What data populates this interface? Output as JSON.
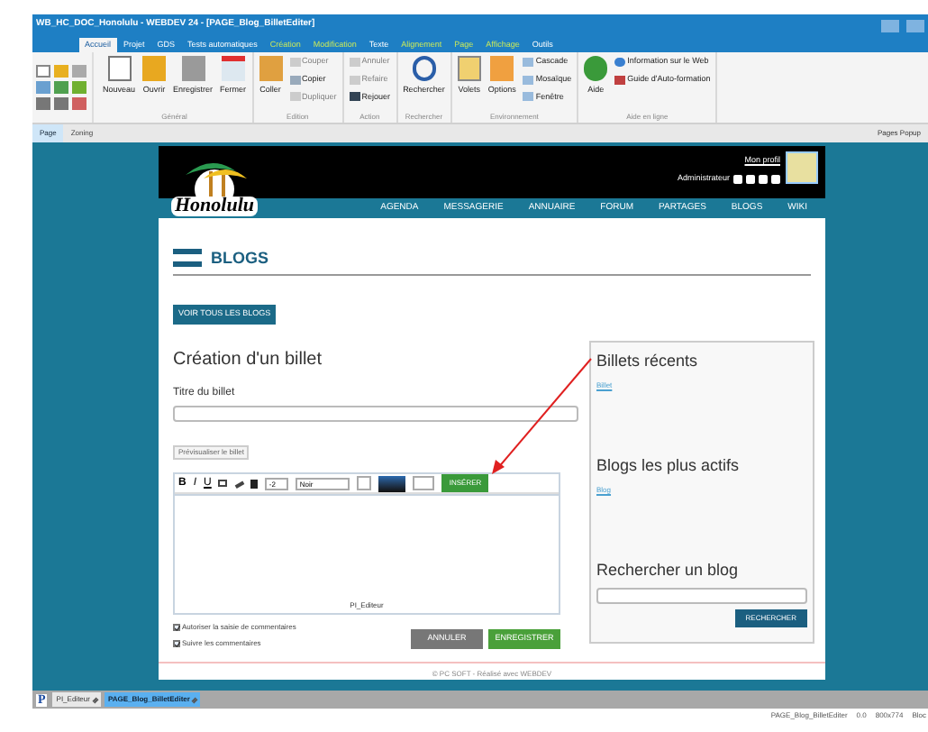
{
  "window": {
    "title": "WB_HC_DOC_Honolulu - WEBDEV 24 - [PAGE_Blog_BilletEditer]"
  },
  "ribbon_tabs": [
    {
      "label": "Accueil",
      "selected": true,
      "contextual": false
    },
    {
      "label": "Projet",
      "selected": false,
      "contextual": false
    },
    {
      "label": "GDS",
      "selected": false,
      "contextual": false
    },
    {
      "label": "Tests automatiques",
      "selected": false,
      "contextual": false
    },
    {
      "label": "Création",
      "selected": false,
      "contextual": true
    },
    {
      "label": "Modification",
      "selected": false,
      "contextual": true
    },
    {
      "label": "Texte",
      "selected": false,
      "contextual": false
    },
    {
      "label": "Alignement",
      "selected": false,
      "contextual": true
    },
    {
      "label": "Page",
      "selected": false,
      "contextual": true
    },
    {
      "label": "Affichage",
      "selected": false,
      "contextual": true
    },
    {
      "label": "Outils",
      "selected": false,
      "contextual": false
    }
  ],
  "ribbon_groups": [
    {
      "label": "Général",
      "items": [
        {
          "label": "Nouveau",
          "kind": "large",
          "disabled": false
        },
        {
          "label": "Ouvrir",
          "kind": "large",
          "disabled": false
        },
        {
          "label": "Enregistrer",
          "kind": "large",
          "disabled": false
        },
        {
          "label": "Fermer",
          "kind": "large",
          "disabled": false
        }
      ]
    },
    {
      "label": "Edition",
      "items": [
        {
          "label": "Coller",
          "kind": "large",
          "disabled": false
        },
        {
          "label": "Couper",
          "kind": "small",
          "disabled": true
        },
        {
          "label": "Copier",
          "kind": "small",
          "disabled": false
        },
        {
          "label": "Dupliquer",
          "kind": "small",
          "disabled": true
        }
      ]
    },
    {
      "label": "Action",
      "items": [
        {
          "label": "Annuler",
          "kind": "small",
          "disabled": true
        },
        {
          "label": "Refaire",
          "kind": "small",
          "disabled": true
        },
        {
          "label": "Rejouer",
          "kind": "small",
          "disabled": false
        }
      ]
    },
    {
      "label": "Rechercher",
      "items": [
        {
          "label": "Rechercher",
          "kind": "large",
          "disabled": false
        }
      ]
    },
    {
      "label": "Environnement",
      "items": [
        {
          "label": "Volets",
          "kind": "large",
          "disabled": false
        },
        {
          "label": "Options",
          "kind": "large",
          "disabled": false
        },
        {
          "label": "Cascade",
          "kind": "small",
          "disabled": false
        },
        {
          "label": "Mosaïque",
          "kind": "small",
          "disabled": false
        },
        {
          "label": "Fenêtre",
          "kind": "small",
          "disabled": false
        }
      ]
    },
    {
      "label": "Aide en ligne",
      "items": [
        {
          "label": "Aide",
          "kind": "large",
          "disabled": false
        },
        {
          "label": "Information sur le Web",
          "kind": "small",
          "disabled": false
        },
        {
          "label": "Guide d'Auto-formation",
          "kind": "small",
          "disabled": false
        }
      ]
    }
  ],
  "editor_tabs": [
    {
      "label": "Page",
      "selected": true
    },
    {
      "label": "Zoning",
      "selected": false
    }
  ],
  "popup_pages_label": "Pages Popup",
  "page": {
    "profile_link": "Mon profil",
    "user": "Administrateur",
    "logo_text": "Honolulu",
    "nav": [
      "AGENDA",
      "MESSAGERIE",
      "ANNUAIRE",
      "FORUM",
      "PARTAGES",
      "BLOGS",
      "WIKI"
    ],
    "heading": "BLOGS",
    "all_blogs_button": "VOIR TOUS LES BLOGS",
    "form": {
      "title": "Création d'un billet",
      "field_label": "Titre du billet",
      "preview_button": "Prévisualiser le billet",
      "toolbar": [
        {
          "label": "B",
          "kind": "bold"
        },
        {
          "label": "I",
          "kind": "italic"
        },
        {
          "label": "U",
          "kind": "underline"
        }
      ],
      "size": "-2",
      "text_color": "Noir",
      "insert_button": "INSÉRER",
      "editor_label": "PI_Editeur",
      "options": [
        {
          "label": "Autoriser la saisie de commentaires",
          "checked": true
        },
        {
          "label": "Suivre les commentaires",
          "checked": true
        }
      ],
      "cancel_button": "ANNULER",
      "save_button": "ENREGISTRER"
    },
    "sidebar": [
      {
        "title": "Billets récents",
        "link": "Billet"
      },
      {
        "title": "Blogs les plus actifs",
        "link": "Blog"
      },
      {
        "title": "Rechercher un blog",
        "button": "RECHERCHER"
      }
    ],
    "footer": "© PC SOFT - Réalisé avec WEBDEV"
  },
  "project_letter": "P",
  "document_tabs": [
    {
      "label": "PI_Editeur",
      "selected": false
    },
    {
      "label": "PAGE_Blog_BilletEditer",
      "selected": true
    }
  ],
  "status_bar": [
    "PAGE_Blog_BilletEditer",
    "0.0",
    "800x774",
    "Bloc"
  ]
}
